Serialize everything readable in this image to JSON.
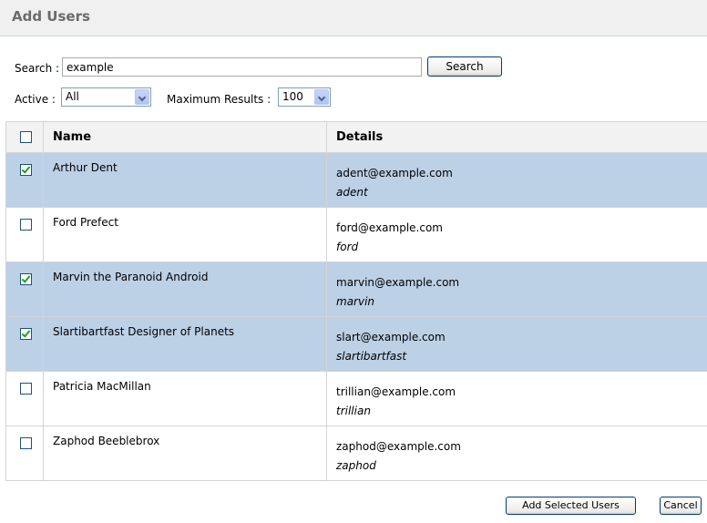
{
  "header": {
    "title": "Add Users"
  },
  "search": {
    "label": "Search :",
    "value": "example",
    "button_label": "Search"
  },
  "filters": {
    "active_label": "Active :",
    "active_value": "All",
    "max_results_label": "Maximum Results :",
    "max_results_value": "100"
  },
  "table": {
    "columns": {
      "name": "Name",
      "details": "Details"
    },
    "select_all_checked": false,
    "rows": [
      {
        "checked": true,
        "name": "Arthur Dent",
        "email": "adent@example.com",
        "username": "adent"
      },
      {
        "checked": false,
        "name": "Ford Prefect",
        "email": "ford@example.com",
        "username": "ford"
      },
      {
        "checked": true,
        "name": "Marvin the Paranoid Android",
        "email": "marvin@example.com",
        "username": "marvin"
      },
      {
        "checked": true,
        "name": "Slartibartfast Designer of Planets",
        "email": "slart@example.com",
        "username": "slartibartfast"
      },
      {
        "checked": false,
        "name": "Patricia MacMillan",
        "email": "trillian@example.com",
        "username": "trillian"
      },
      {
        "checked": false,
        "name": "Zaphod Beeblebrox",
        "email": "zaphod@example.com",
        "username": "zaphod"
      }
    ]
  },
  "footer": {
    "add_label": "Add Selected Users",
    "cancel_label": "Cancel"
  },
  "colors": {
    "selected_row": "#bcd0e6",
    "header_bg": "#f0f0f0",
    "check_mark": "#21a121"
  }
}
